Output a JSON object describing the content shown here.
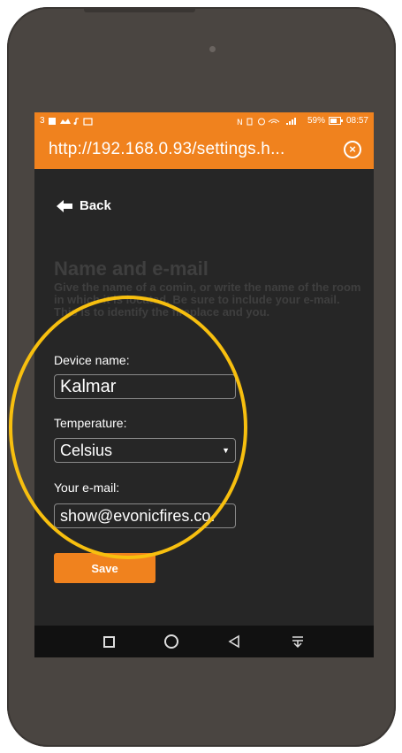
{
  "status": {
    "left_text": "3",
    "battery": "59%",
    "time": "08:57"
  },
  "browser": {
    "url": "http://192.168.0.93/settings.h..."
  },
  "nav": {
    "back_label": "Back"
  },
  "section": {
    "title": "Name and e-mail",
    "description": "Give the name of a comin, or write the name of the room in which it is located. Be sure to include your e-mail. This is to identify the fireplace and you."
  },
  "form": {
    "device_label": "Device name:",
    "device_value": "Kalmar",
    "temperature_label": "Temperature:",
    "temperature_value": "Celsius",
    "email_label": "Your e-mail:",
    "email_value": "show@evonicfires.co.",
    "save_label": "Save"
  },
  "colors": {
    "accent": "#f0821e",
    "background": "#262626",
    "highlight": "#f7bf0f"
  }
}
